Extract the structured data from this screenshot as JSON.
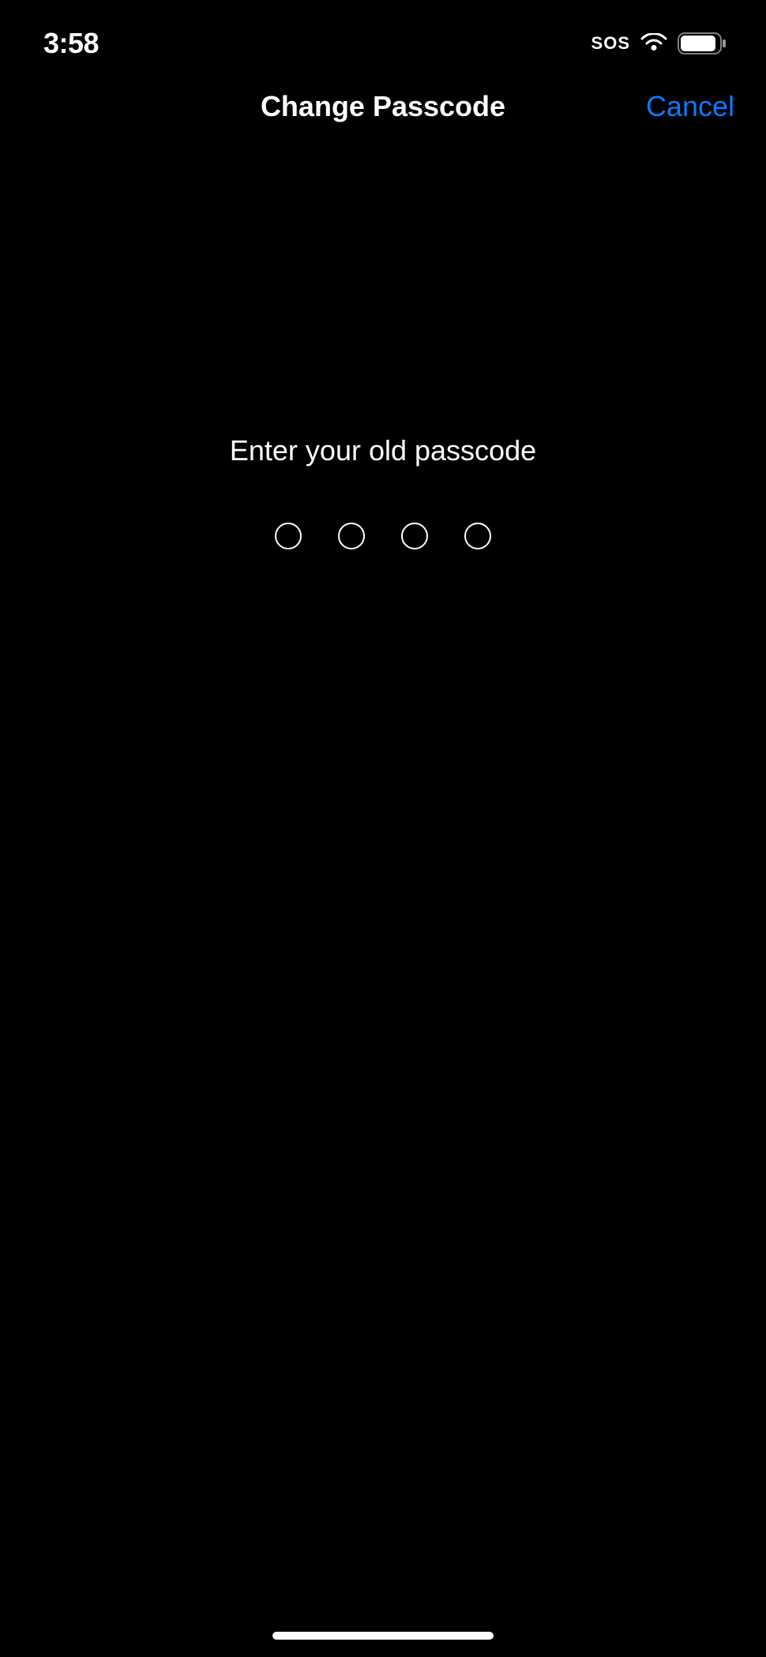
{
  "status_bar": {
    "time": "3:58",
    "sos": "SOS"
  },
  "nav": {
    "title": "Change Passcode",
    "cancel": "Cancel"
  },
  "content": {
    "prompt": "Enter your old passcode",
    "passcode_length": 4
  }
}
